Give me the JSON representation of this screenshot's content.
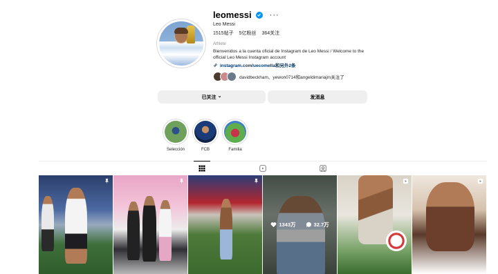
{
  "profile": {
    "username": "leomessi",
    "more": "···",
    "full_name": "Leo Messi",
    "stats": {
      "posts": "1515帖子",
      "followers": "5亿粉丝",
      "following": "364关注"
    },
    "category": "Athlete",
    "bio": "Bienvenidos a la cuenta oficial de Instagram de Leo Messi / Welcome to the official Leo Messi Instagram account",
    "link": "instagram.com/uecomella和另外2条",
    "followed_by": "davidbeckham、yewon0714和angeldimariajm关注了"
  },
  "actions": {
    "following_label": "已关注",
    "following_chevron": "⌄",
    "message_label": "发消息"
  },
  "highlights": [
    {
      "label": "Selección"
    },
    {
      "label": "FCB"
    },
    {
      "label": "Familia"
    }
  ],
  "tabs": [
    "posts-grid",
    "reels",
    "tagged"
  ],
  "hovered_post": {
    "likes": "1343万",
    "comments": "32.7万"
  },
  "colors": {
    "verified": "#0095f6",
    "button_bg": "#efefef",
    "link": "#00376b"
  }
}
